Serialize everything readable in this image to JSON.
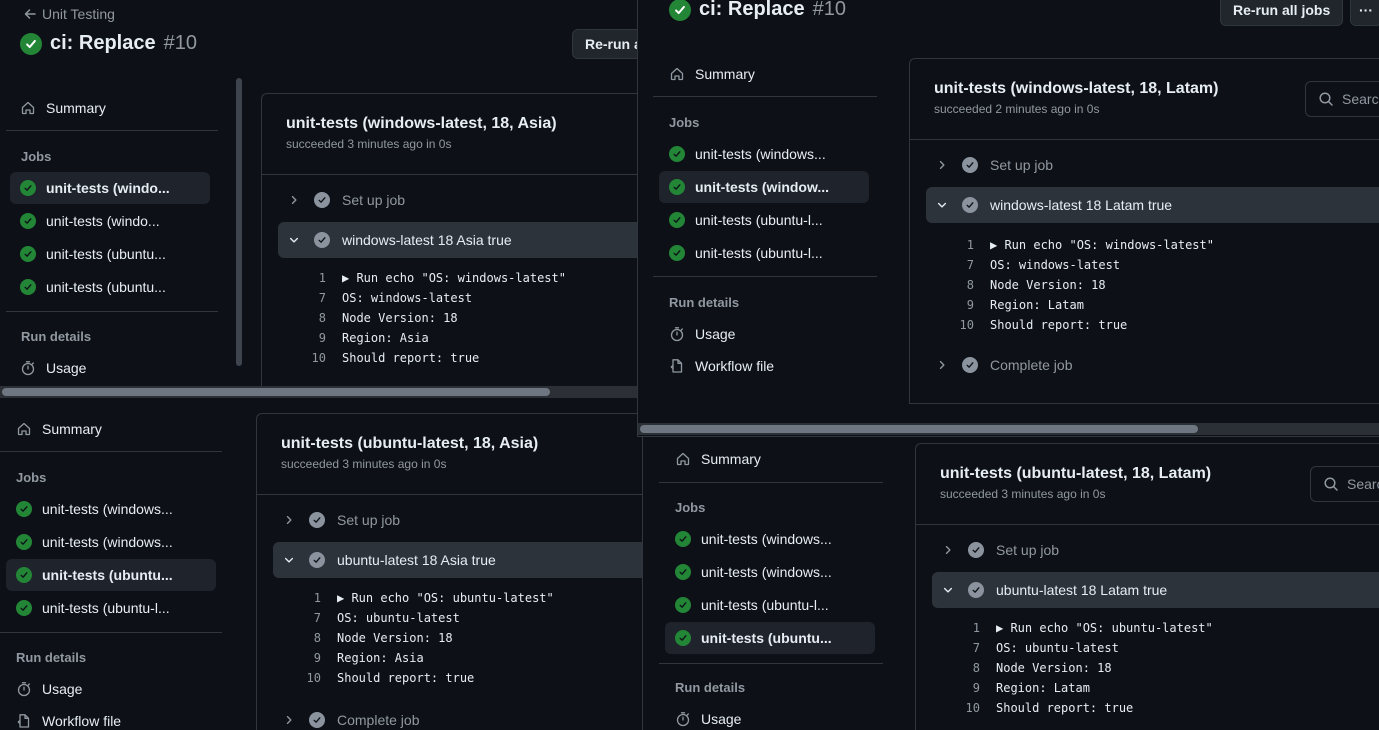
{
  "windows": {
    "a": {
      "back_label": "Unit Testing",
      "title": "ci: Replace",
      "run_number": "#10",
      "rerun_label": "Re-run a",
      "job": {
        "title": "unit-tests (windows-latest, 18, Asia)",
        "subtitle": "succeeded 3 minutes ago in 0s"
      },
      "steps": [
        {
          "label": "Set up job",
          "expanded": false
        },
        {
          "label": "windows-latest 18 Asia true",
          "expanded": true
        }
      ],
      "log": [
        {
          "n": "1",
          "t": "▶ Run echo \"OS: windows-latest\""
        },
        {
          "n": "7",
          "t": "OS: windows-latest"
        },
        {
          "n": "8",
          "t": "Node Version: 18"
        },
        {
          "n": "9",
          "t": "Region: Asia"
        },
        {
          "n": "10",
          "t": "Should report: true"
        }
      ],
      "sidebar": {
        "summary": "Summary",
        "jobs_heading": "Jobs",
        "jobs": [
          "unit-tests (windo...",
          "unit-tests (windo...",
          "unit-tests (ubuntu...",
          "unit-tests (ubuntu..."
        ],
        "run_details_heading": "Run details",
        "usage": "Usage"
      }
    },
    "b": {
      "title": "ci: Replace",
      "run_number": "#10",
      "rerun_label": "Re-run all jobs",
      "more_label": "···",
      "search_placeholder": "Search",
      "job": {
        "title": "unit-tests (windows-latest, 18, Latam)",
        "subtitle": "succeeded 2 minutes ago in 0s"
      },
      "steps": [
        {
          "label": "Set up job",
          "expanded": false
        },
        {
          "label": "windows-latest 18 Latam true",
          "expanded": true
        },
        {
          "label": "Complete job",
          "expanded": false
        }
      ],
      "log": [
        {
          "n": "1",
          "t": "▶ Run echo \"OS: windows-latest\""
        },
        {
          "n": "7",
          "t": "OS: windows-latest"
        },
        {
          "n": "8",
          "t": "Node Version: 18"
        },
        {
          "n": "9",
          "t": "Region: Latam"
        },
        {
          "n": "10",
          "t": "Should report: true"
        }
      ],
      "sidebar": {
        "summary": "Summary",
        "jobs_heading": "Jobs",
        "jobs": [
          "unit-tests (windows...",
          "unit-tests (window...",
          "unit-tests (ubuntu-l...",
          "unit-tests (ubuntu-l..."
        ],
        "run_details_heading": "Run details",
        "usage": "Usage",
        "workflow_file": "Workflow file"
      }
    },
    "c": {
      "job": {
        "title": "unit-tests (ubuntu-latest, 18, Asia)",
        "subtitle": "succeeded 3 minutes ago in 0s"
      },
      "steps": [
        {
          "label": "Set up job",
          "expanded": false
        },
        {
          "label": "ubuntu-latest 18 Asia true",
          "expanded": true
        },
        {
          "label": "Complete job",
          "expanded": false
        }
      ],
      "log": [
        {
          "n": "1",
          "t": "▶ Run echo \"OS: ubuntu-latest\""
        },
        {
          "n": "7",
          "t": "OS: ubuntu-latest"
        },
        {
          "n": "8",
          "t": "Node Version: 18"
        },
        {
          "n": "9",
          "t": "Region: Asia"
        },
        {
          "n": "10",
          "t": "Should report: true"
        }
      ],
      "sidebar": {
        "summary": "Summary",
        "jobs_heading": "Jobs",
        "jobs": [
          "unit-tests (windows...",
          "unit-tests (windows...",
          "unit-tests (ubuntu...",
          "unit-tests (ubuntu-l..."
        ],
        "run_details_heading": "Run details",
        "usage": "Usage",
        "workflow_file": "Workflow file"
      }
    },
    "d": {
      "search_placeholder": "Searc",
      "job": {
        "title": "unit-tests (ubuntu-latest, 18, Latam)",
        "subtitle": "succeeded 3 minutes ago in 0s"
      },
      "steps": [
        {
          "label": "Set up job",
          "expanded": false
        },
        {
          "label": "ubuntu-latest 18 Latam true",
          "expanded": true
        }
      ],
      "log": [
        {
          "n": "1",
          "t": "▶ Run echo \"OS: ubuntu-latest\""
        },
        {
          "n": "7",
          "t": "OS: ubuntu-latest"
        },
        {
          "n": "8",
          "t": "Node Version: 18"
        },
        {
          "n": "9",
          "t": "Region: Latam"
        },
        {
          "n": "10",
          "t": "Should report: true"
        }
      ],
      "sidebar": {
        "summary": "Summary",
        "jobs_heading": "Jobs",
        "jobs": [
          "unit-tests (windows...",
          "unit-tests (windows...",
          "unit-tests (ubuntu-l...",
          "unit-tests (ubuntu..."
        ],
        "run_details_heading": "Run details",
        "usage": "Usage"
      }
    }
  },
  "colors": {
    "success": "#238636",
    "accent": "#2f81f7",
    "background": "#0d1117"
  }
}
